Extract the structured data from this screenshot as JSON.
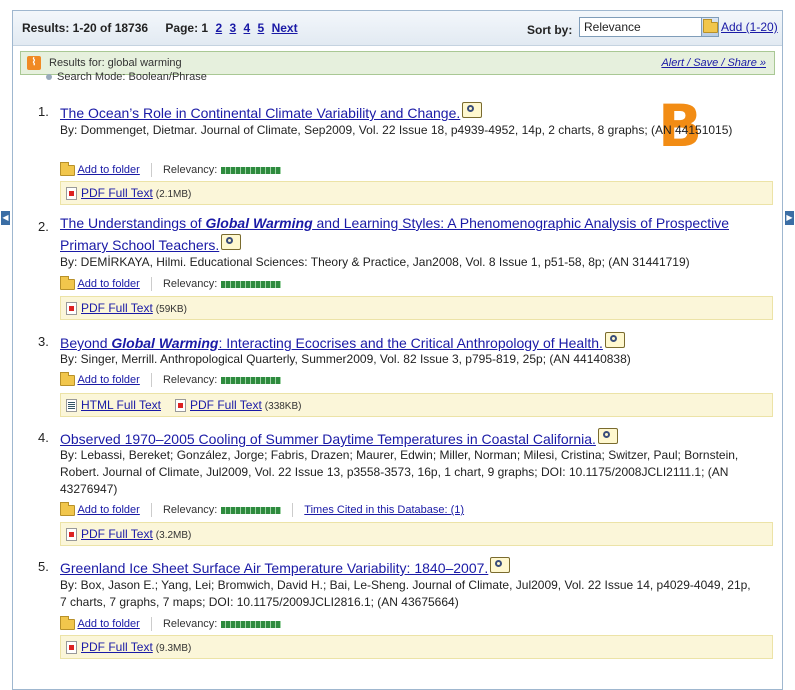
{
  "header": {
    "results_label": "Results: 1-20 of 18736",
    "page_label": "Page: 1",
    "pages": [
      "2",
      "3",
      "4",
      "5"
    ],
    "next_label": "Next",
    "sort_label": "Sort by:",
    "sort_value": "Relevance",
    "add_label": "Add (1-20)"
  },
  "rss": {
    "results_for": "Results for:  global warming",
    "alert_label": "Alert / Save / Share »"
  },
  "search_mode": "Search Mode: Boolean/Phrase",
  "overlay_letter": "B",
  "common": {
    "add_to_folder": "Add to folder",
    "relevancy": "Relevancy:",
    "pdf_full_text": "PDF Full Text",
    "html_full_text": "HTML Full Text",
    "times_cited": "Times Cited in this Database: (1)"
  },
  "records": [
    {
      "num": "1.",
      "title": "The Ocean’s Role in Continental Climate Variability and Change.",
      "byline": "By: Dommenget, Dietmar. Journal of Climate, Sep2009, Vol. 22 Issue 18, p4939-4952, 14p, 2 charts, 8 graphs; (AN 44151015)",
      "pdf_size": "(2.1MB)"
    },
    {
      "num": "2.",
      "title_pre": "The Understandings of ",
      "title_em": "Global Warming",
      "title_post": " and Learning Styles: A Phenomenographic Analysis of Prospective Primary School Teachers.",
      "byline": "By: DEMİRKAYA, Hilmi. Educational Sciences: Theory & Practice, Jan2008, Vol. 8 Issue 1, p51-58, 8p; (AN 31441719)",
      "pdf_size": "(59KB)"
    },
    {
      "num": "3.",
      "title_pre": "Beyond ",
      "title_em": "Global Warming",
      "title_post": ": Interacting Ecocrises and the Critical Anthropology of Health.",
      "byline": "By: Singer, Merrill. Anthropological Quarterly, Summer2009, Vol. 82 Issue 3, p795-819, 25p; (AN 44140838)",
      "pdf_size": "(338KB)"
    },
    {
      "num": "4.",
      "title": "Observed 1970–2005 Cooling of Summer Daytime Temperatures in Coastal California.",
      "byline": "By: Lebassi, Bereket; González, Jorge; Fabris, Drazen; Maurer, Edwin; Miller, Norman; Milesi, Cristina; Switzer, Paul; Bornstein, Robert. Journal of Climate, Jul2009, Vol. 22 Issue 13, p3558-3573, 16p, 1 chart, 9 graphs; DOI: 10.1175/2008JCLI2111.1; (AN 43276947)",
      "pdf_size": "(3.2MB)"
    },
    {
      "num": "5.",
      "title": "Greenland Ice Sheet Surface Air Temperature Variability: 1840–2007.",
      "byline": "By: Box, Jason E.; Yang, Lei; Bromwich, David H.; Bai, Le-Sheng. Journal of Climate, Jul2009, Vol. 22 Issue 14, p4029-4049, 21p, 7 charts, 7 graphs, 7 maps; DOI: 10.1175/2009JCLI2816.1; (AN 43675664)",
      "pdf_size": "(9.3MB)"
    }
  ]
}
